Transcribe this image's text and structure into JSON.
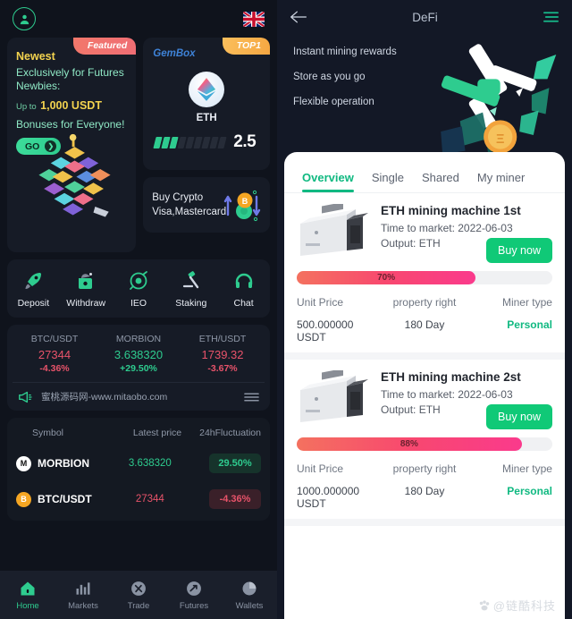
{
  "left": {
    "topbar": {
      "avatar": "user-avatar",
      "language_flag": "uk-flag"
    },
    "promo": {
      "badge": "Featured",
      "title": "Newest",
      "line1": "Exclusively for Futures",
      "line2": "Newbies:",
      "upto": "Up to",
      "amount": "1,000 USDT",
      "line3": "Bonuses for Everyone!",
      "cta": "GO"
    },
    "gembox": {
      "title": "GemBox",
      "badge": "TOP1",
      "coin": "ETH",
      "segments_total": 10,
      "segments_filled": 3,
      "value": "2.5"
    },
    "buy_crypto": {
      "line1": "Buy Crypto",
      "line2": "Visa,Mastercard"
    },
    "quick_actions": [
      {
        "label": "Deposit",
        "icon": "rocket-icon"
      },
      {
        "label": "Withdraw",
        "icon": "wallet-icon"
      },
      {
        "label": "IEO",
        "icon": "atom-icon"
      },
      {
        "label": "Staking",
        "icon": "gavel-icon"
      },
      {
        "label": "Chat",
        "icon": "headset-icon"
      }
    ],
    "tickers": [
      {
        "name": "BTC/USDT",
        "price": "27344",
        "change": "-4.36%",
        "dir": "down"
      },
      {
        "name": "MORBION",
        "price": "3.638320",
        "change": "+29.50%",
        "dir": "up"
      },
      {
        "name": "ETH/USDT",
        "price": "1739.32",
        "change": "-3.67%",
        "dir": "down"
      }
    ],
    "notice": "蜜桃源码网-www.mitaobo.com",
    "market": {
      "headers": {
        "symbol": "Symbol",
        "price": "Latest price",
        "change": "24hFluctuation"
      },
      "rows": [
        {
          "symbol": "MORBION",
          "price": "3.638320",
          "change": "29.50%",
          "dir": "up"
        },
        {
          "symbol": "BTC/USDT",
          "price": "27344",
          "change": "-4.36%",
          "dir": "down"
        }
      ]
    },
    "bottom_nav": [
      {
        "label": "Home",
        "icon": "home-icon",
        "active": true
      },
      {
        "label": "Markets",
        "icon": "bars-icon",
        "active": false
      },
      {
        "label": "Trade",
        "icon": "trade-icon",
        "active": false
      },
      {
        "label": "Futures",
        "icon": "futures-icon",
        "active": false
      },
      {
        "label": "Wallets",
        "icon": "pie-wallet-icon",
        "active": false
      }
    ]
  },
  "right": {
    "topbar": {
      "back": "back-arrow-icon",
      "title": "DeFi",
      "menu": "hamburger-icon"
    },
    "hero": {
      "lines": [
        "Instant mining rewards",
        "Store as you go",
        "Flexible operation"
      ]
    },
    "tabs": [
      {
        "label": "Overview",
        "active": true
      },
      {
        "label": "Single",
        "active": false
      },
      {
        "label": "Shared",
        "active": false
      },
      {
        "label": "My miner",
        "active": false
      }
    ],
    "kv_labels": {
      "unit_price": "Unit Price",
      "property_right": "property right",
      "miner_type": "Miner type"
    },
    "miners": [
      {
        "name": "ETH mining machine 1st",
        "time_label": "Time to market:",
        "time_value": "2022-06-03",
        "output_label": "Output:",
        "output_value": "ETH",
        "buy_label": "Buy now",
        "progress": 70,
        "progress_text": "70%",
        "unit_price": "500.000000 USDT",
        "property_right": "180 Day",
        "miner_type": "Personal"
      },
      {
        "name": "ETH mining machine 2st",
        "time_label": "Time to market:",
        "time_value": "2022-06-03",
        "output_label": "Output:",
        "output_value": "ETH",
        "buy_label": "Buy now",
        "progress": 88,
        "progress_text": "88%",
        "unit_price": "1000.000000 USDT",
        "property_right": "180 Day",
        "miner_type": "Personal"
      }
    ],
    "watermark": "@链酷科技"
  },
  "colors": {
    "accent_green": "#2ecc8f",
    "buy_green": "#10c977",
    "up": "#2ecc8f",
    "down": "#e8536a",
    "yellow": "#f3d34f",
    "progress_start": "#f4715f",
    "progress_end": "#fa3a8c"
  }
}
